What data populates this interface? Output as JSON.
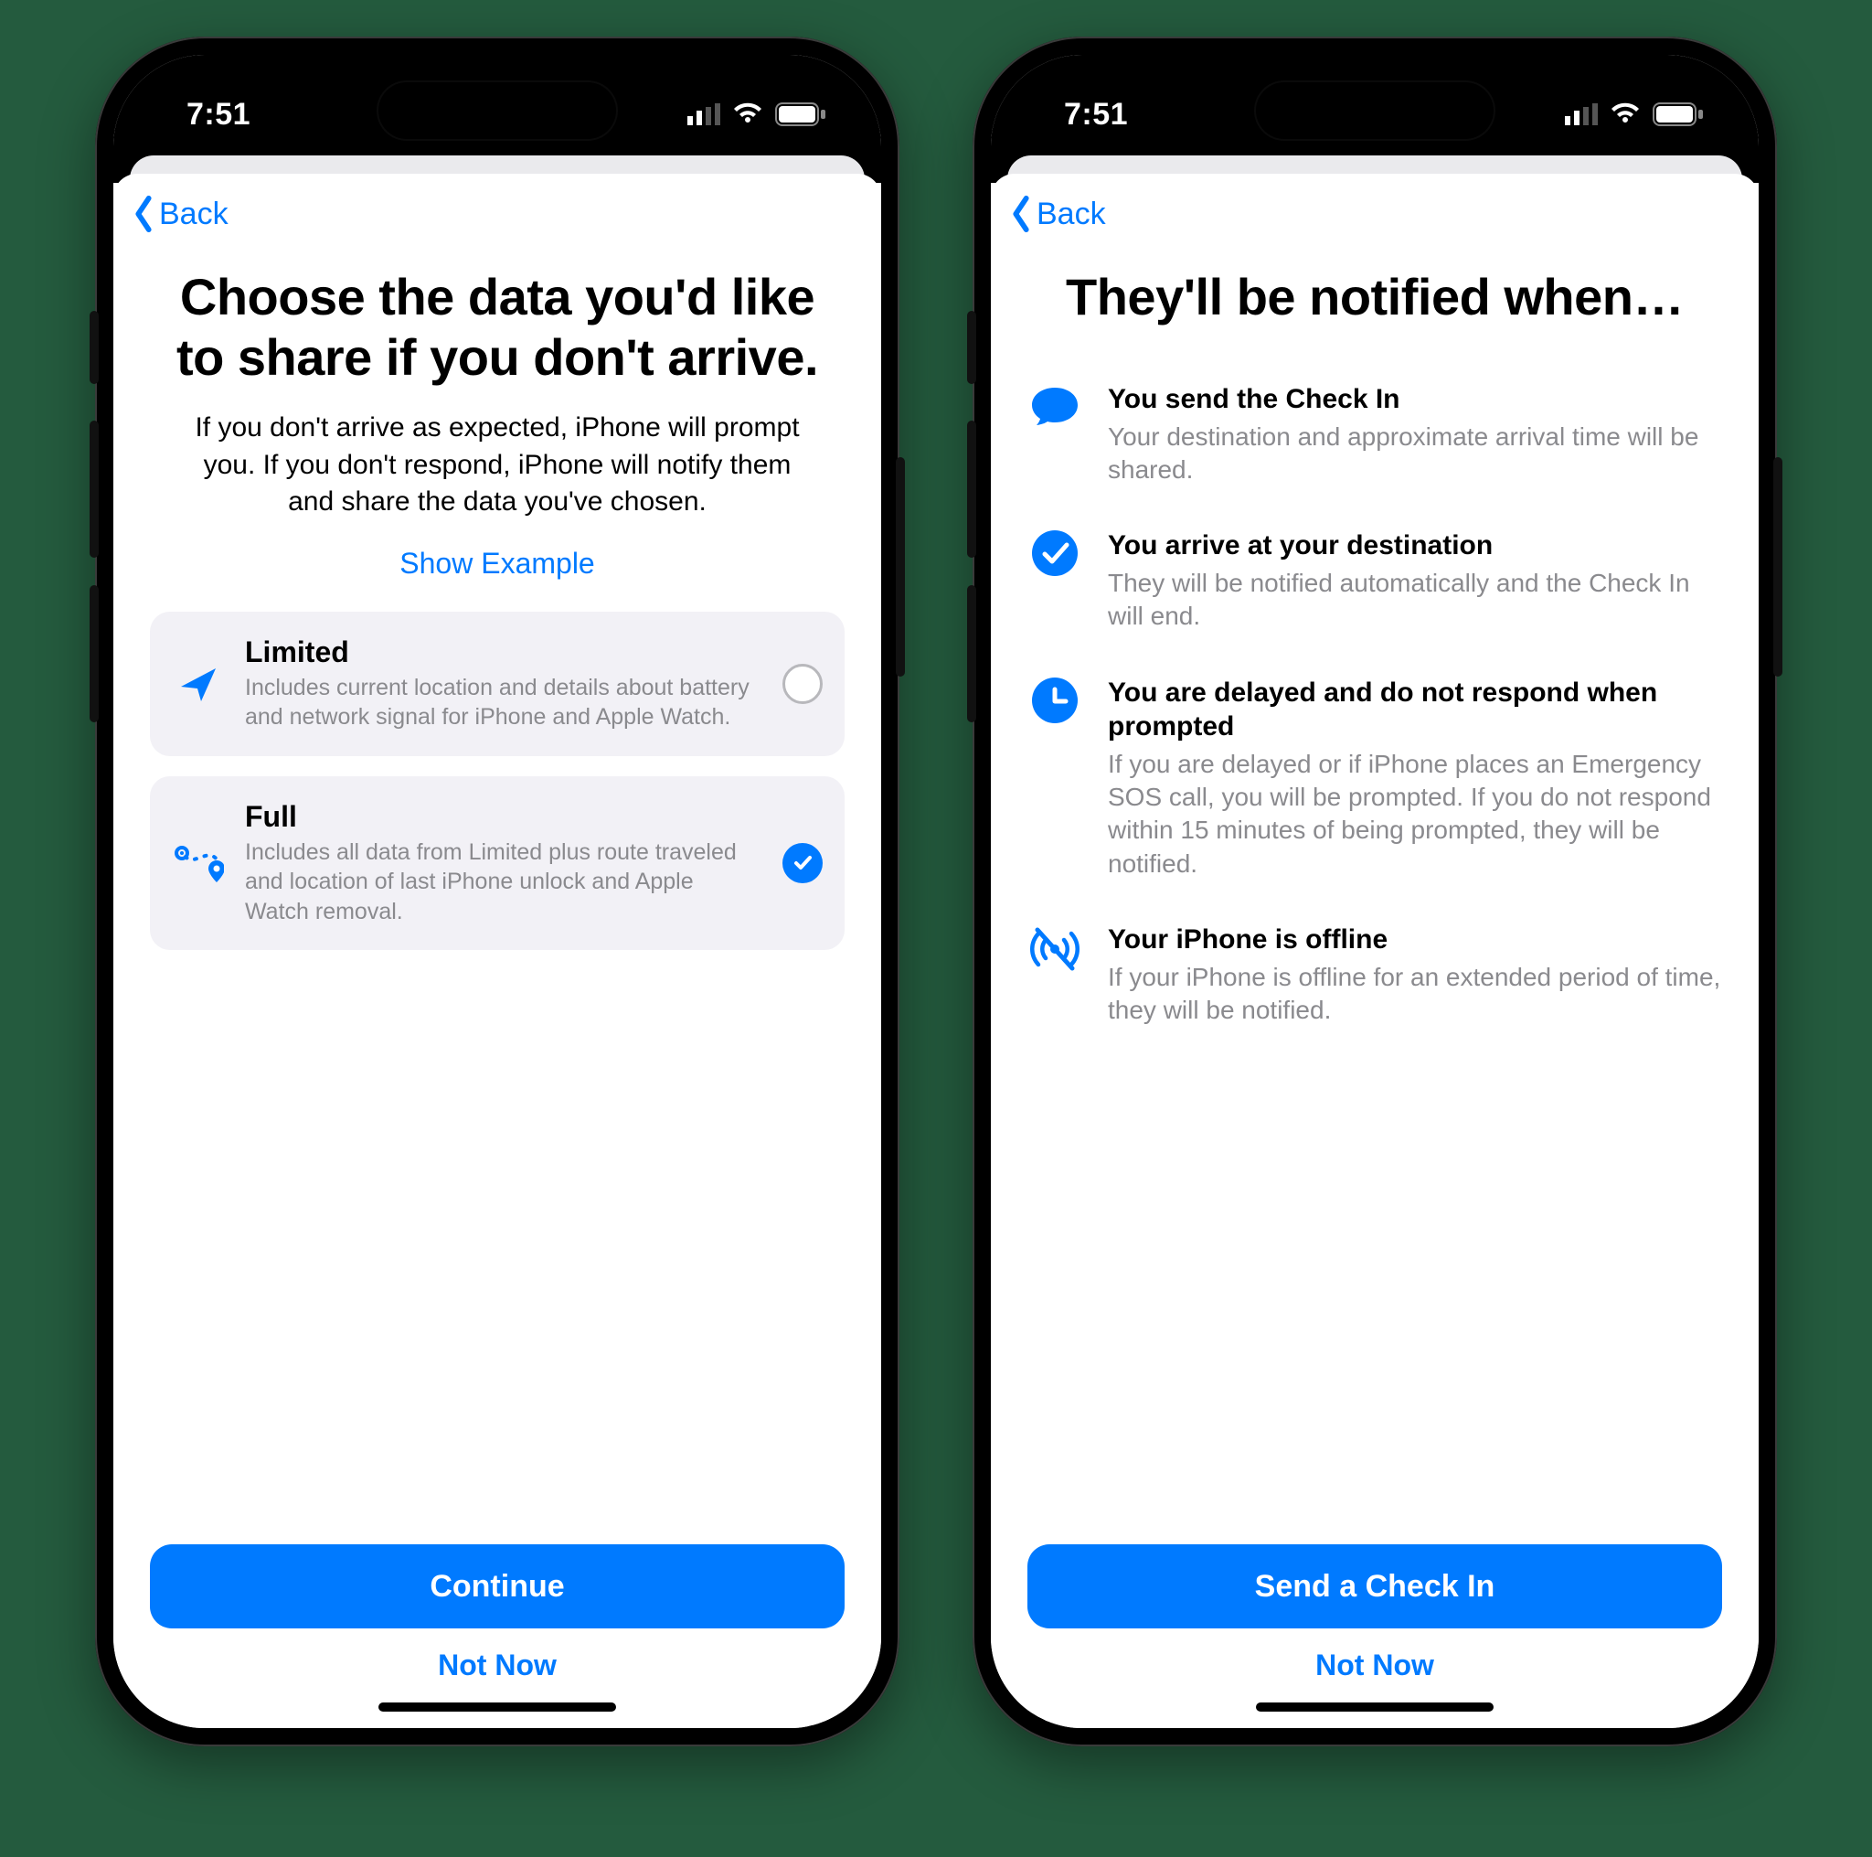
{
  "status": {
    "time": "7:51"
  },
  "nav": {
    "back": "Back"
  },
  "screenA": {
    "title": "Choose the data you'd like to share if you don't arrive.",
    "subtitle": "If you don't arrive as expected, iPhone will prompt you. If you don't respond, iPhone will notify them and share the data you've chosen.",
    "show_example": "Show Example",
    "option_limited": {
      "title": "Limited",
      "desc": "Includes current location and details about battery and network signal for iPhone and Apple Watch."
    },
    "option_full": {
      "title": "Full",
      "desc": "Includes all data from Limited plus route traveled and location of last iPhone unlock and Apple Watch removal."
    },
    "primary": "Continue",
    "secondary": "Not Now"
  },
  "screenB": {
    "title": "They'll be notified when…",
    "rows": [
      {
        "title": "You send the Check In",
        "desc": "Your destination and approximate arrival time will be shared."
      },
      {
        "title": "You arrive at your destination",
        "desc": "They will be notified automatically and the Check In will end."
      },
      {
        "title": "You are delayed and do not respond when prompted",
        "desc": "If you are delayed or if iPhone places an Emergency SOS call, you will be prompted. If you do not respond within 15 minutes of being prompted, they will be notified."
      },
      {
        "title": "Your iPhone is offline",
        "desc": "If your iPhone is offline for an extended period of time, they will be notified."
      }
    ],
    "primary": "Send a Check In",
    "secondary": "Not Now"
  },
  "colors": {
    "accent": "#007aff"
  }
}
